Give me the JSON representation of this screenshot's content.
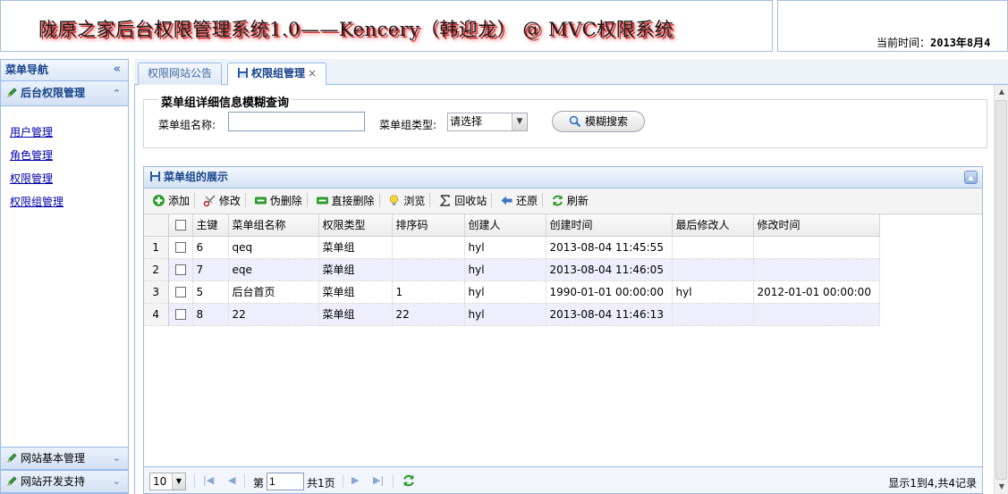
{
  "header": {
    "title": "陇原之家后台权限管理系统1.0——Kencery（韩迎龙） @ MVC权限系统",
    "time_label": "当前时间：",
    "time_value": "2013年8月4"
  },
  "sidebar": {
    "title": "菜单导航",
    "collapse_glyph": "«",
    "section": "后台权限管理",
    "items": [
      {
        "label": "用户管理"
      },
      {
        "label": "角色管理"
      },
      {
        "label": "权限管理"
      },
      {
        "label": "权限组管理"
      }
    ],
    "bottom_sections": [
      {
        "label": "网站基本管理"
      },
      {
        "label": "网站开发支持"
      }
    ]
  },
  "tabs": [
    {
      "label": "权限网站公告",
      "active": false
    },
    {
      "label": "权限组管理",
      "active": true,
      "close": "×"
    }
  ],
  "query": {
    "legend": "菜单组详细信息模糊查询",
    "name_label": "菜单组名称:",
    "name_value": "",
    "type_label": "菜单组类型:",
    "type_value": "请选择",
    "search_label": "模糊搜索"
  },
  "grid": {
    "title": "菜单组的展示",
    "toolbar": [
      {
        "label": "添加",
        "icon": "add-icon"
      },
      {
        "label": "修改",
        "icon": "scissors-icon"
      },
      {
        "label": "伪删除",
        "icon": "remove-icon"
      },
      {
        "label": "直接删除",
        "icon": "remove-icon"
      },
      {
        "label": "浏览",
        "icon": "lightbulb-icon"
      },
      {
        "label": "回收站",
        "icon": "sigma-icon"
      },
      {
        "label": "还原",
        "icon": "back-arrow-icon"
      },
      {
        "label": "刷新",
        "icon": "refresh-icon"
      }
    ],
    "columns": [
      "主键",
      "菜单组名称",
      "权限类型",
      "排序码",
      "创建人",
      "创建时间",
      "最后修改人",
      "修改时间"
    ],
    "rows": [
      {
        "num": "1",
        "cells": [
          "6",
          "qeq",
          "菜单组",
          "",
          "hyl",
          "2013-08-04 11:45:55",
          "",
          ""
        ]
      },
      {
        "num": "2",
        "cells": [
          "7",
          "eqe",
          "菜单组",
          "",
          "hyl",
          "2013-08-04 11:46:05",
          "",
          ""
        ]
      },
      {
        "num": "3",
        "cells": [
          "5",
          "后台首页",
          "菜单组",
          "1",
          "hyl",
          "1990-01-01 00:00:00",
          "hyl",
          "2012-01-01 00:00:00"
        ]
      },
      {
        "num": "4",
        "cells": [
          "8",
          "22",
          "菜单组",
          "22",
          "hyl",
          "2013-08-04 11:46:13",
          "",
          ""
        ]
      }
    ]
  },
  "pager": {
    "page_size": "10",
    "page_prefix": "第",
    "page_value": "1",
    "page_total": "共1页",
    "info": "显示1到4,共4记录"
  },
  "colors": {
    "border": "#99bbe8",
    "header_text": "#15428b",
    "link": "#0000aa",
    "alt_row": "#eeeefc"
  }
}
